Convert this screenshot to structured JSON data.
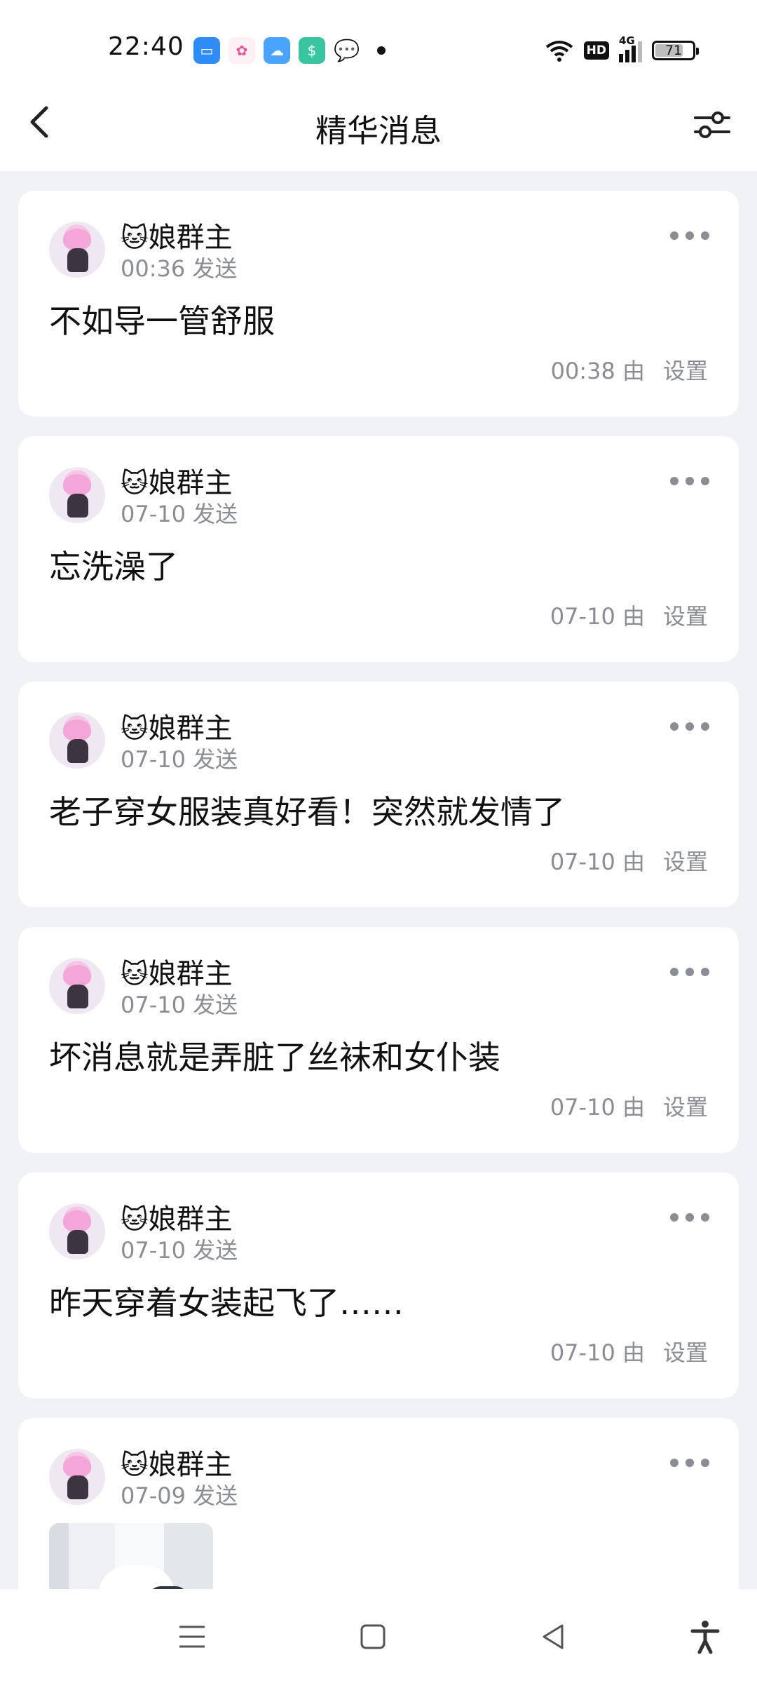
{
  "status_bar": {
    "time": "22:40",
    "battery": "71",
    "network_badge": "HD",
    "network_type": "4G",
    "app_icons": [
      "files-icon",
      "photos-icon",
      "weather-icon",
      "wallet-icon",
      "wechat-icon"
    ]
  },
  "header": {
    "title": "精华消息",
    "back_icon": "chevron-left-icon",
    "filter_icon": "sliders-icon"
  },
  "messages": [
    {
      "emoji": "🐱",
      "sender": "娘群主",
      "sent": "00:36 发送",
      "content": "不如导一管舒服",
      "set_time": "00:38 由",
      "set_label": "设置"
    },
    {
      "emoji": "🐱",
      "sender": "娘群主",
      "sent": "07-10 发送",
      "content": "忘洗澡了",
      "set_time": "07-10 由",
      "set_label": "设置"
    },
    {
      "emoji": "🐱",
      "sender": "娘群主",
      "sent": "07-10 发送",
      "content": "老子穿女服装真好看！突然就发情了",
      "set_time": "07-10 由",
      "set_label": "设置"
    },
    {
      "emoji": "🐱",
      "sender": "娘群主",
      "sent": "07-10 发送",
      "content": "坏消息就是弄脏了丝袜和女仆装",
      "set_time": "07-10 由",
      "set_label": "设置"
    },
    {
      "emoji": "🐱",
      "sender": "娘群主",
      "sent": "07-10 发送",
      "content": "昨天穿着女装起飞了……",
      "set_time": "07-10 由",
      "set_label": "设置"
    },
    {
      "emoji": "🐱",
      "sender": "娘群主",
      "sent": "07-09 发送",
      "content": "",
      "has_image": true
    }
  ],
  "nav_bar": {
    "icons": [
      "menu-icon",
      "home-icon",
      "back-triangle-icon",
      "accessibility-icon"
    ]
  }
}
